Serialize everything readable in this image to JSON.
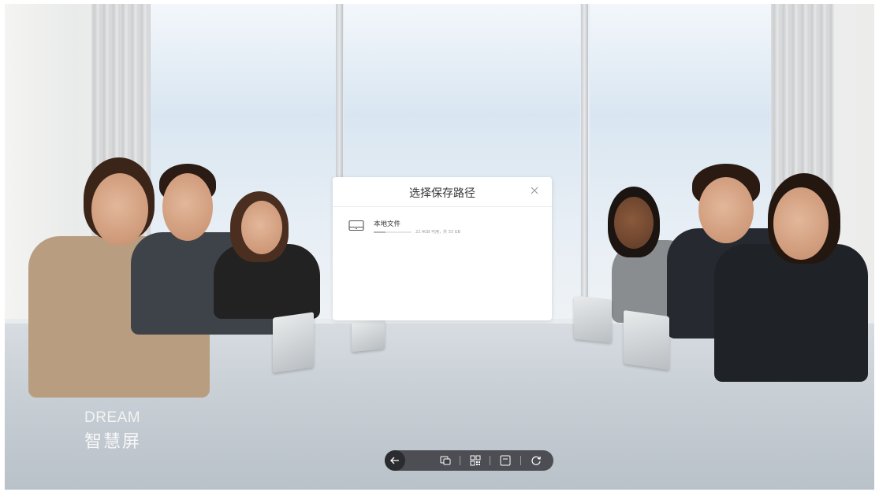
{
  "dialog": {
    "title": "选择保存路径",
    "close_icon": "close-icon",
    "locations": [
      {
        "name": "本地文件",
        "capacity_text": "22.4GB 可用，共 33 GB",
        "used_fraction": 0.32,
        "icon": "drive-icon"
      }
    ]
  },
  "watermark": {
    "brand_en": "DREAM",
    "brand_cn": "智慧屏"
  },
  "toolbar": {
    "buttons": [
      "back-arrow-icon",
      "window-switch-icon",
      "qr-code-icon",
      "save-icon",
      "refresh-icon"
    ]
  },
  "colors": {
    "dialog_bg": "#ffffff",
    "toolbar_bg": "#3c3e42",
    "text": "#333333"
  }
}
